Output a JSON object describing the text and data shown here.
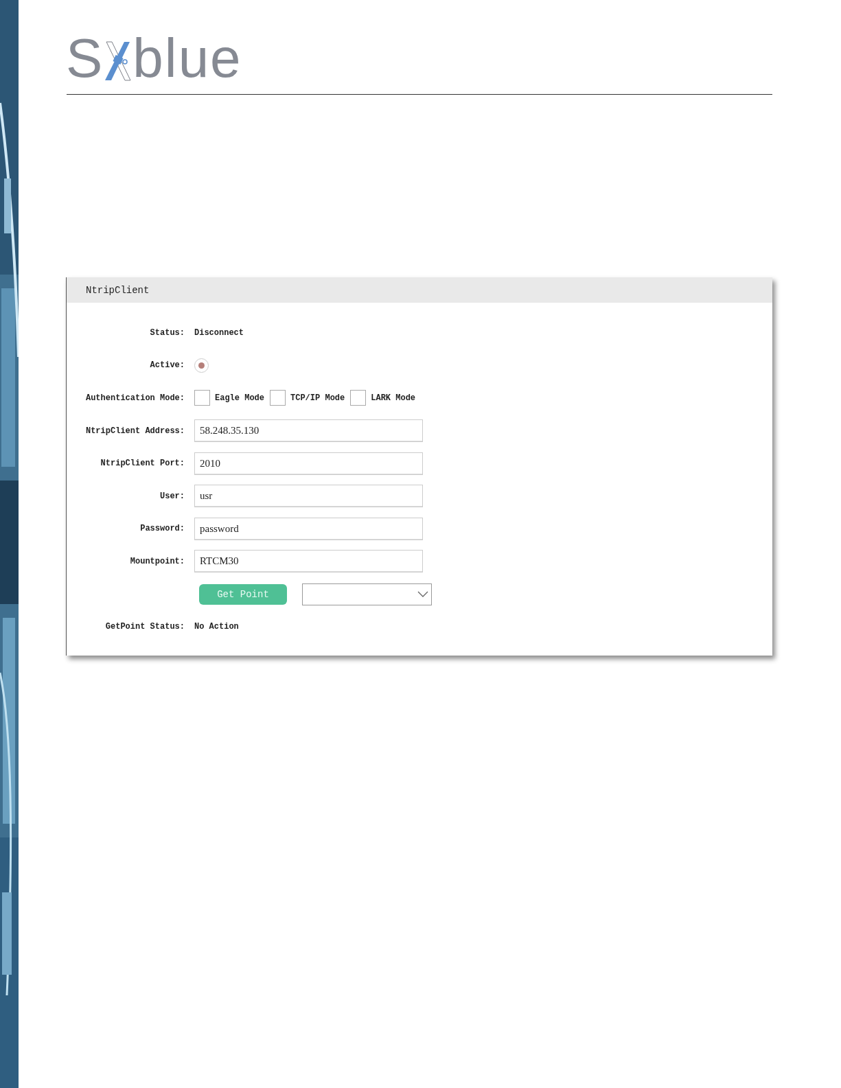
{
  "logo": {
    "left": "S",
    "right": "blue"
  },
  "panel": {
    "title": "NtripClient",
    "rows": [
      {
        "kind": "text",
        "label": "Status:",
        "value": "Disconnect"
      },
      {
        "kind": "radio",
        "label": "Active:",
        "selected": true
      },
      {
        "kind": "checkboxes",
        "label": "Authentication Mode:",
        "options": [
          {
            "label": "Eagle Mode",
            "checked": false
          },
          {
            "label": "TCP/IP Mode",
            "checked": false
          },
          {
            "label": "LARK Mode",
            "checked": false
          }
        ]
      },
      {
        "kind": "input",
        "label": "NtripClient Address:",
        "value": "58.248.35.130"
      },
      {
        "kind": "input",
        "label": "NtripClient Port:",
        "value": "2010"
      },
      {
        "kind": "input",
        "label": "User:",
        "value": "usr"
      },
      {
        "kind": "input",
        "label": "Password:",
        "value": "password"
      },
      {
        "kind": "input",
        "label": "Mountpoint:",
        "value": "RTCM30"
      },
      {
        "kind": "button",
        "button": "Get Point"
      },
      {
        "kind": "text",
        "label": "GetPoint Status:",
        "value": "No Action"
      }
    ]
  }
}
